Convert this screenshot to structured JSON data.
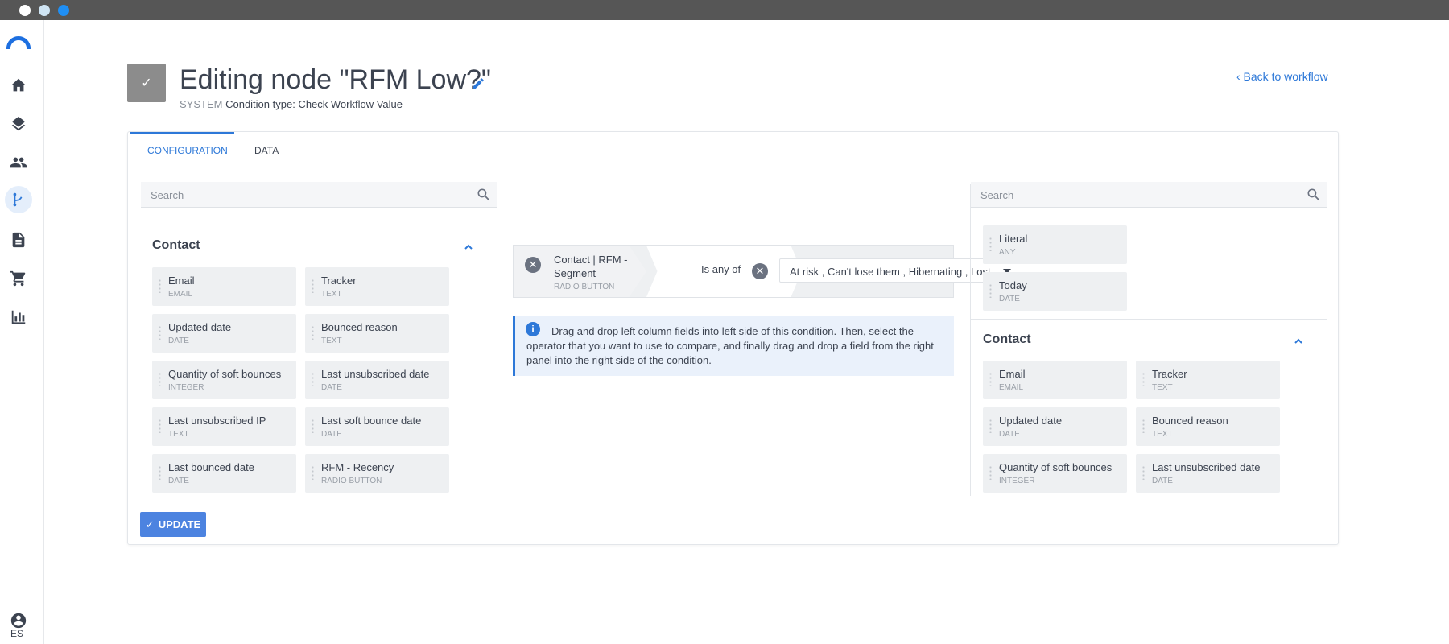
{
  "window": {
    "title": ""
  },
  "rail": {
    "items": [
      "home-icon",
      "layers-icon",
      "contacts-icon",
      "workflow-icon",
      "document-icon",
      "cart-icon",
      "reports-icon"
    ],
    "language": "ES"
  },
  "header": {
    "check": "✓",
    "title": "Editing node \"RFM Low?\"",
    "system_label": "SYSTEM",
    "condition_type": "Condition type: Check Workflow Value",
    "back_label": "‹  Back to workflow"
  },
  "tabs": [
    {
      "label": "CONFIGURATION",
      "active": true
    },
    {
      "label": "DATA",
      "active": false
    }
  ],
  "left_panel": {
    "search_placeholder": "Search",
    "section": "Contact",
    "fields": [
      {
        "name": "Email",
        "type": "EMAIL"
      },
      {
        "name": "Tracker",
        "type": "TEXT"
      },
      {
        "name": "Updated date",
        "type": "DATE"
      },
      {
        "name": "Bounced reason",
        "type": "TEXT"
      },
      {
        "name": "Quantity of soft bounces",
        "type": "INTEGER"
      },
      {
        "name": "Last unsubscribed date",
        "type": "DATE"
      },
      {
        "name": "Last unsubscribed IP",
        "type": "TEXT"
      },
      {
        "name": "Last soft bounce date",
        "type": "DATE"
      },
      {
        "name": "Last bounced date",
        "type": "DATE"
      },
      {
        "name": "RFM - Recency",
        "type": "RADIO BUTTON"
      }
    ]
  },
  "condition": {
    "field": "Contact | RFM - Segment",
    "field_type": "RADIO BUTTON",
    "operator": "Is any of",
    "value": "At risk , Can't lose them , Hibernating , Lost",
    "remove_symbol": "✕"
  },
  "info": {
    "icon": "i",
    "text": "Drag and drop left column fields into left side of this condition. Then, select the operator that you want to use to compare, and finally drag and drop a field from the right panel into the right side of the condition."
  },
  "right_panel": {
    "search_placeholder": "Search",
    "special_fields": [
      {
        "name": "Literal",
        "type": "ANY"
      },
      {
        "name": "Today",
        "type": "DATE"
      }
    ],
    "section": "Contact",
    "fields": [
      {
        "name": "Email",
        "type": "EMAIL"
      },
      {
        "name": "Tracker",
        "type": "TEXT"
      },
      {
        "name": "Updated date",
        "type": "DATE"
      },
      {
        "name": "Bounced reason",
        "type": "TEXT"
      },
      {
        "name": "Quantity of soft bounces",
        "type": "INTEGER"
      },
      {
        "name": "Last unsubscribed date",
        "type": "DATE"
      }
    ]
  },
  "footer": {
    "update_label": "UPDATE",
    "update_icon": "✓"
  },
  "colors": {
    "accent": "#2d78d8",
    "button": "#4c83e0",
    "field_bg": "#eef0f2"
  }
}
